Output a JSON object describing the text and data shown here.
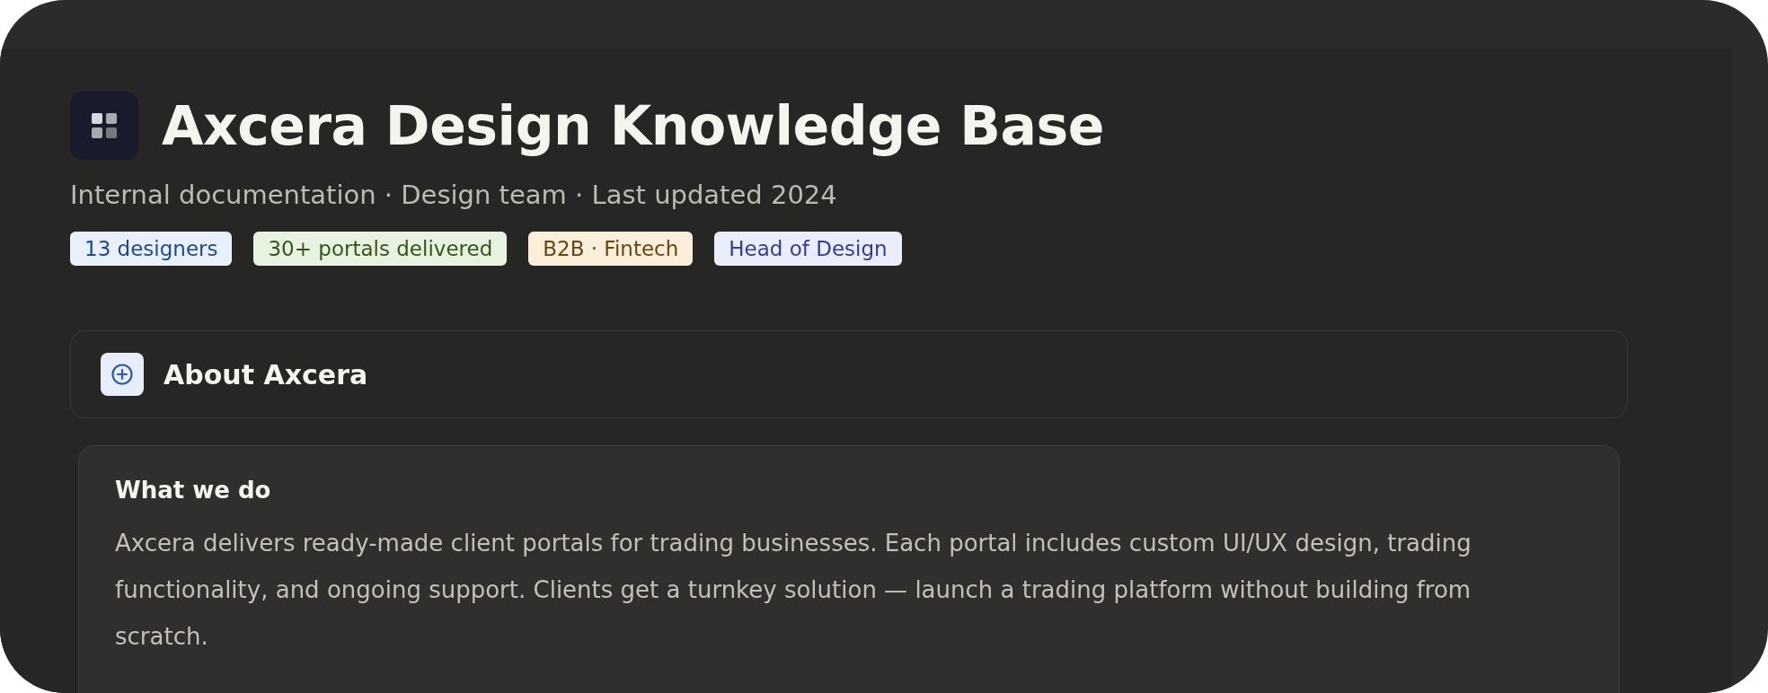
{
  "header": {
    "title": "Axcera Design Knowledge Base",
    "subtitle": "Internal documentation · Design team · Last updated 2024"
  },
  "tags": [
    {
      "label": "13 designers",
      "color": "#e9effb"
    },
    {
      "label": "30+ portals delivered",
      "color": "#e8f2e0"
    },
    {
      "label": "B2B · Fintech",
      "color": "#fbefdc"
    },
    {
      "label": "Head of Design",
      "color": "#eaedfb"
    }
  ],
  "section": {
    "title": "About Axcera",
    "card": {
      "heading": "What we do",
      "text": "Axcera delivers ready-made client portals for trading businesses. Each portal includes custom UI/UX design, trading functionality, and ongoing support. Clients get a turnkey solution — launch a trading platform without building from scratch."
    }
  }
}
